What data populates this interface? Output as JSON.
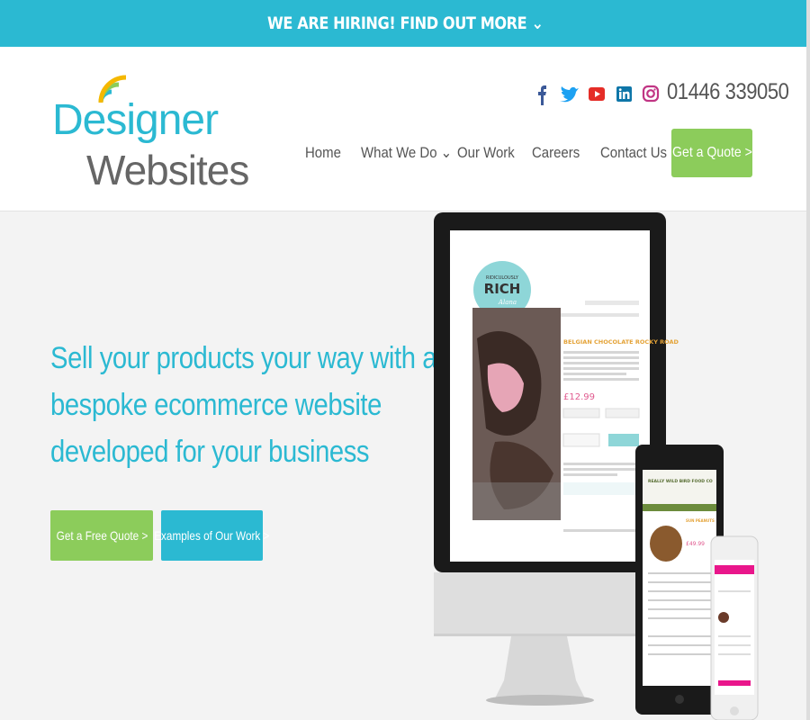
{
  "top_banner": {
    "text": "WE ARE HIRING! FIND OUT MORE ⌄"
  },
  "logo": {
    "line1": "Designer",
    "line2": "Websites"
  },
  "social_icons": [
    "facebook-icon",
    "twitter-icon",
    "youtube-icon",
    "linkedin-icon",
    "instagram-icon"
  ],
  "phone": "01446 339050",
  "nav": {
    "items": [
      {
        "label": "Home"
      },
      {
        "label": "What We Do ⌄"
      },
      {
        "label": "Our Work"
      },
      {
        "label": "Careers"
      },
      {
        "label": "Contact Us"
      }
    ],
    "quote_label": "Get a Quote >"
  },
  "hero": {
    "line1": "Sell your products your way with a",
    "line2": "bespoke ecommerce website",
    "line3": "developed for your business",
    "free_quote_label": "Get a Free Quote >",
    "examples_label": "Examples of Our Work >"
  },
  "showcase": {
    "brand_top": "RIDICULOUSLY",
    "brand_main": "RICH",
    "brand_sub": "Alana",
    "product_title": "BELGIAN CHOCOLATE ROCKY ROAD",
    "price": "£12.99",
    "tablet_brand": "REALLY WILD BIRD FOOD CO",
    "tablet_product": "SUN PEANUTS",
    "tablet_price": "£49.99"
  },
  "colors": {
    "brand_teal": "#2bb9d2",
    "brand_green": "#8ccc5b",
    "text_grey": "#555555"
  }
}
